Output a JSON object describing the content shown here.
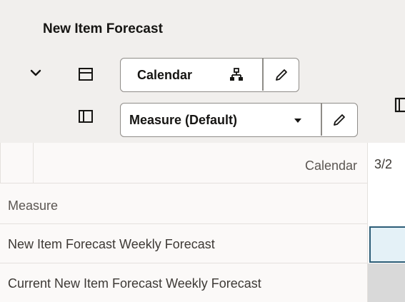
{
  "header": {
    "title": "New Item Forecast"
  },
  "pivot": {
    "rows_chip": {
      "label": "Calendar"
    },
    "columns_chip": {
      "label": "Measure (Default)"
    }
  },
  "grid": {
    "calendar_header": "Calendar",
    "measure_header": "Measure",
    "column_date": "3/2",
    "rows": [
      {
        "label": "New Item Forecast Weekly Forecast"
      },
      {
        "label": "Current New Item Forecast Weekly Forecast"
      }
    ]
  },
  "colors": {
    "header_bg": "#f1efed",
    "selected_cell_bg": "#e4f1f7",
    "selected_cell_border": "#2c5d77",
    "readonly_cell_bg": "#d9d9d9"
  }
}
